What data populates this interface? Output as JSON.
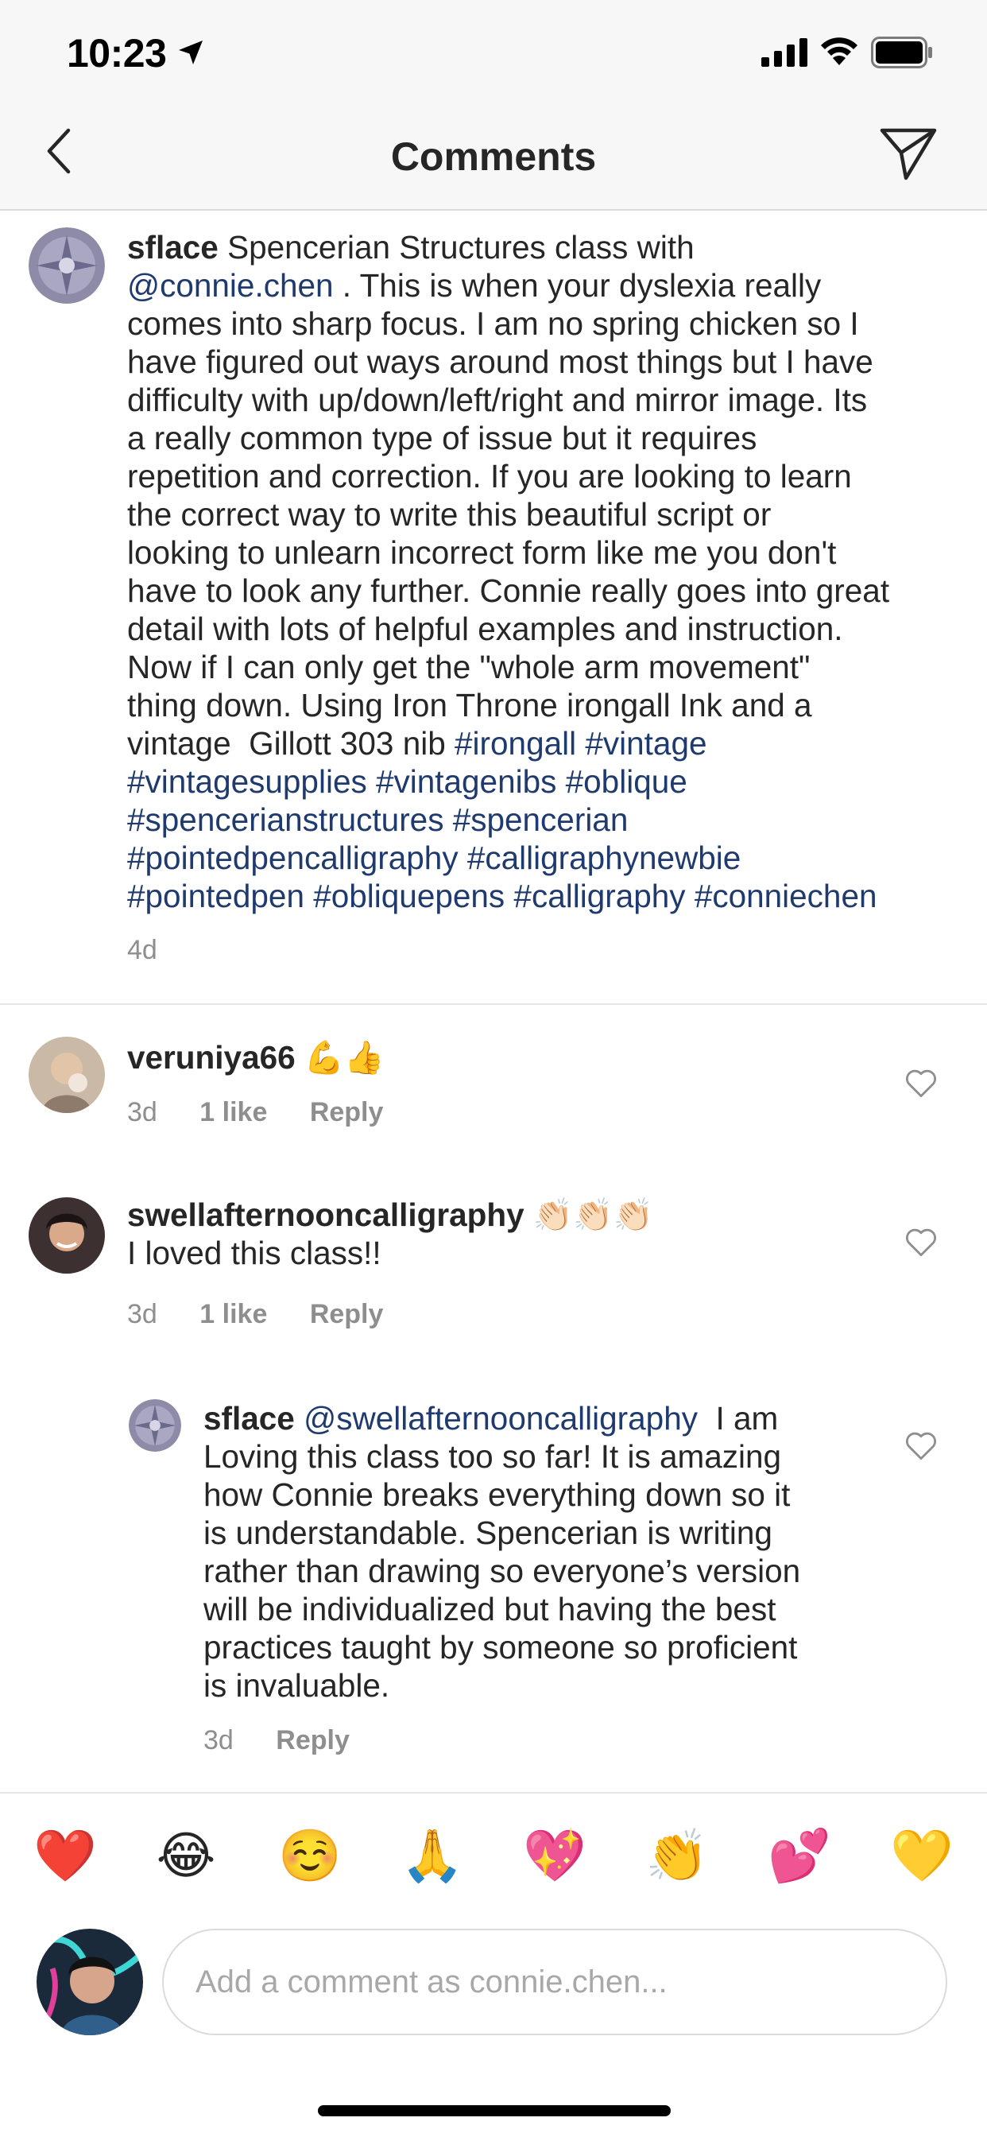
{
  "status_bar": {
    "time": "10:23"
  },
  "nav": {
    "title": "Comments"
  },
  "post": {
    "username": "sflace",
    "text_before_mention": " Spencerian Structures class with",
    "mention": "@connie.chen",
    "lines": [
      " . This is when your dyslexia really",
      "comes into sharp focus. I am no spring chicken so I",
      "have figured out ways around most things but I have",
      "difficulty with up/down/left/right and mirror image. Its",
      "a really common type of issue but it requires",
      "repetition and correction. If you are looking to learn",
      "the correct way to write this beautiful script or",
      "looking to unlearn incorrect form like me you don't",
      "have to look any further. Connie really goes into great",
      "detail with lots of helpful examples and instruction.",
      "Now if I can only get the \"whole arm movement\"",
      "thing down. Using Iron Throne irongall Ink and a",
      "vintage  Gillott 303 nib "
    ],
    "hashtag_line_1": "#irongall #vintage",
    "hashtag_lines": [
      "#vintagesupplies #vintagenibs #oblique",
      "#spencerianstructures #spencerian",
      "#pointedpencalligraphy #calligraphynewbie",
      "#pointedpen #obliquepens #calligraphy #conniechen"
    ],
    "time": "4d"
  },
  "comments": [
    {
      "username": "veruniya66",
      "emojis": "💪👍",
      "text": "",
      "time": "3d",
      "likes": "1 like",
      "reply": "Reply"
    },
    {
      "username": "swellafternooncalligraphy",
      "emojis": "👏🏻👏🏻👏🏻",
      "text": "I loved this class!!",
      "time": "3d",
      "likes": "1 like",
      "reply": "Reply"
    }
  ],
  "reply": {
    "username": "sflace",
    "mention": "@swellafternooncalligraphy",
    "first_line_rest": "  I am",
    "lines": [
      "Loving this class too so far! It is amazing",
      "how Connie breaks everything down so it",
      "is understandable. Spencerian is writing",
      "rather than drawing so everyone’s version",
      "will be individualized but having the best",
      "practices taught by someone so proficient",
      "is invaluable."
    ],
    "time": "3d",
    "reply": "Reply"
  },
  "emoji_bar": [
    "❤️",
    "😂",
    "☺️",
    "🙏",
    "💖",
    "👏",
    "💕",
    "💛"
  ],
  "input": {
    "placeholder": "Add a comment as connie.chen..."
  },
  "colors": {
    "link": "#1f3a6e",
    "meta": "#8e8e8e",
    "text": "#262626"
  }
}
